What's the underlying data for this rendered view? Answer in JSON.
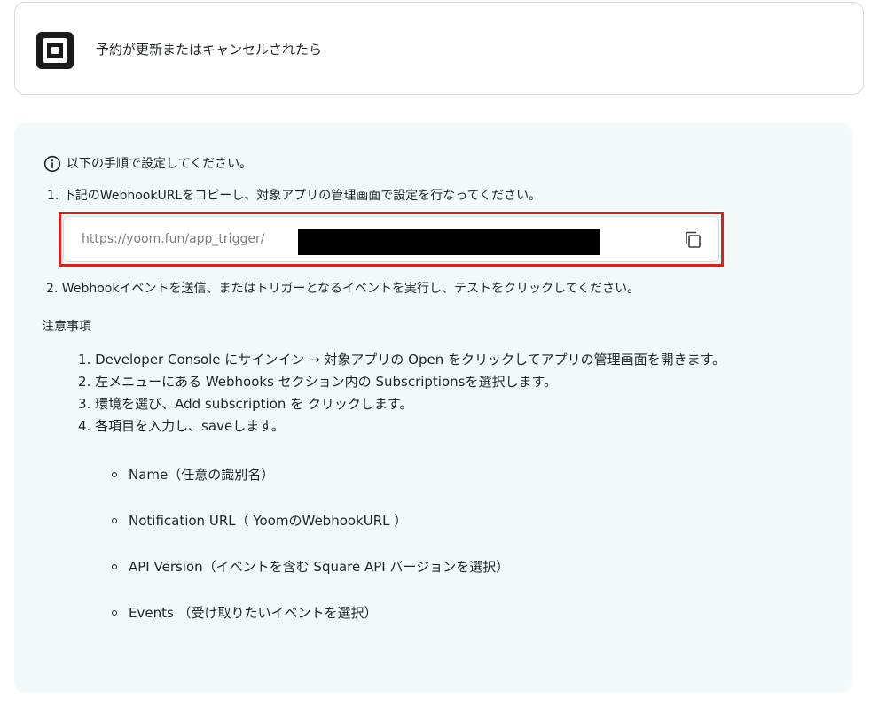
{
  "trigger": {
    "title": "予約が更新またはキャンセルされたら",
    "app_icon": "square-logo-icon"
  },
  "instructions": {
    "intro": "以下の手順で設定してください。",
    "step1": "1. 下記のWebhookURLをコピーし、対象アプリの管理画面で設定を行なってください。",
    "webhook_url_visible": "https://yoom.fun/app_trigger/",
    "copy_icon": "copy-icon",
    "step2": "2. Webhookイベントを送信、またはトリガーとなるイベントを実行し、テストをクリックしてください。"
  },
  "notes": {
    "heading": "注意事項",
    "items": [
      "1.  Developer Console にサインイン → 対象アプリの Open をクリックしてアプリの管理画面を開きます。",
      "2.  左メニューにある Webhooks セクション内の Subscriptionsを選択します。",
      "3. 環境を選び、Add subscription を クリックします。",
      "4. 各項目を入力し、saveします。"
    ],
    "fields": [
      "Name（任意の識別名）",
      "Notification URL（ YoomのWebhookURL ）",
      "API Version（イベントを含む Square API バージョンを選択）",
      "Events （受け取りたいイベントを選択）"
    ]
  },
  "colors": {
    "panel_bg": "#f1faf8",
    "highlight_border": "#d9201b",
    "redaction": "#000000"
  }
}
